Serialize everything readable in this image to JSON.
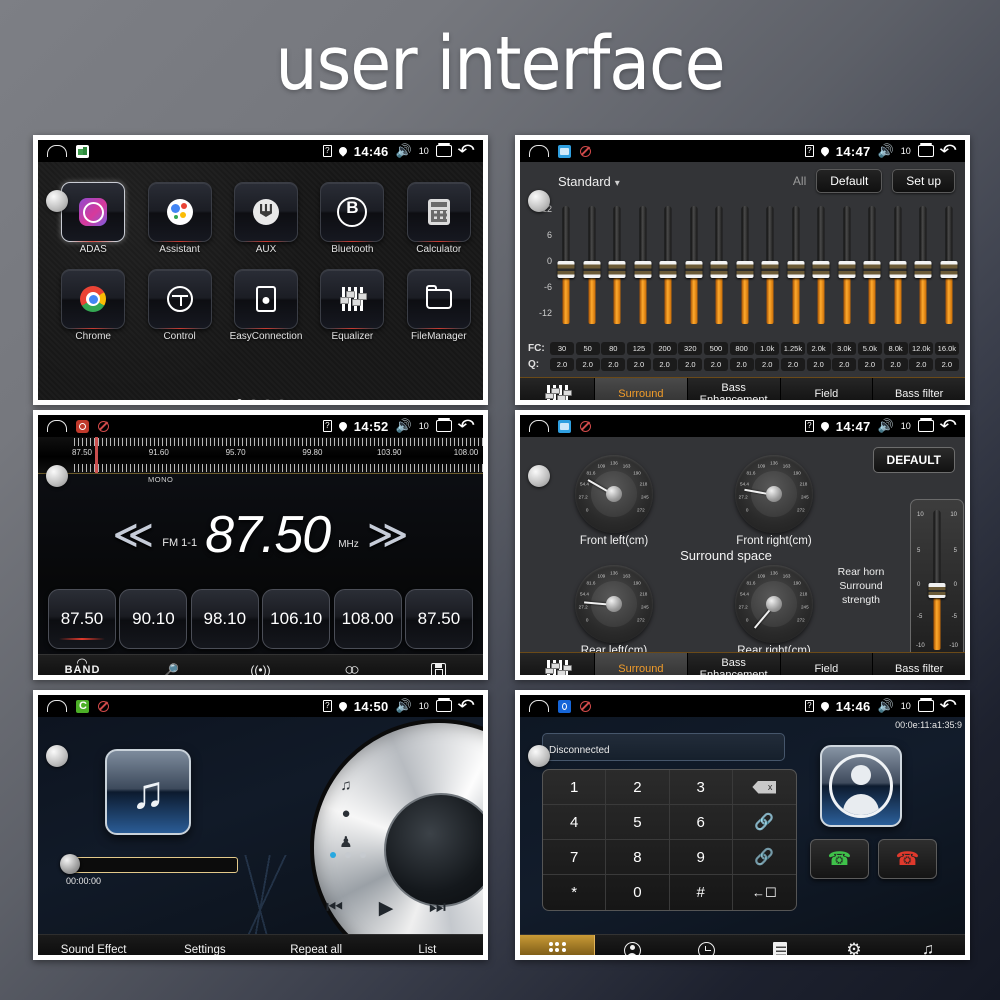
{
  "page": {
    "title": "user interface"
  },
  "statusbar_common": {
    "sim_icon": "sim-card-icon",
    "location_icon": "location-pin-icon",
    "volume_icon": "volume-icon",
    "volume_level": "10",
    "recents_icon": "recents-icon",
    "back_icon": "back-icon",
    "home_icon": "car-home-icon"
  },
  "panels": {
    "launcher": {
      "name": "app-launcher",
      "status": {
        "time": "14:46",
        "volume_level": "10",
        "app_badge": "home-app-icon"
      },
      "apps": [
        {
          "label": "ADAS",
          "icon": "adas-icon",
          "selected": true
        },
        {
          "label": "Assistant",
          "icon": "google-assistant-icon",
          "selected": false
        },
        {
          "label": "AUX",
          "icon": "aux-icon",
          "selected": false
        },
        {
          "label": "Bluetooth",
          "icon": "bluetooth-icon",
          "selected": false
        },
        {
          "label": "Calculator",
          "icon": "calculator-icon",
          "selected": false
        },
        {
          "label": "Chrome",
          "icon": "chrome-icon",
          "selected": false
        },
        {
          "label": "Control",
          "icon": "steering-wheel-icon",
          "selected": false
        },
        {
          "label": "EasyConnection",
          "icon": "easyconnection-icon",
          "selected": false
        },
        {
          "label": "Equalizer",
          "icon": "equalizer-icon",
          "selected": false
        },
        {
          "label": "FileManager",
          "icon": "folder-icon",
          "selected": false
        }
      ],
      "page_dots": {
        "count": 4,
        "active_index": 0
      }
    },
    "equalizer": {
      "name": "equalizer",
      "status": {
        "time": "14:47",
        "volume_level": "10",
        "app_badge": "blue-app-icon"
      },
      "preset": "Standard",
      "all_label": "All",
      "default_button": "Default",
      "setup_button": "Set up",
      "axis_labels": [
        "12",
        "6",
        "0",
        "-6",
        "-12"
      ],
      "fc_label": "FC:",
      "q_label": "Q:",
      "bands": [
        {
          "fc": "30",
          "q": "2.0",
          "gain": 0
        },
        {
          "fc": "50",
          "q": "2.0",
          "gain": 0
        },
        {
          "fc": "80",
          "q": "2.0",
          "gain": 0
        },
        {
          "fc": "125",
          "q": "2.0",
          "gain": 0
        },
        {
          "fc": "200",
          "q": "2.0",
          "gain": 0
        },
        {
          "fc": "320",
          "q": "2.0",
          "gain": 0
        },
        {
          "fc": "500",
          "q": "2.0",
          "gain": 0
        },
        {
          "fc": "800",
          "q": "2.0",
          "gain": 0
        },
        {
          "fc": "1.0k",
          "q": "2.0",
          "gain": 0
        },
        {
          "fc": "1.25k",
          "q": "2.0",
          "gain": 0
        },
        {
          "fc": "2.0k",
          "q": "2.0",
          "gain": 0
        },
        {
          "fc": "3.0k",
          "q": "2.0",
          "gain": 0
        },
        {
          "fc": "5.0k",
          "q": "2.0",
          "gain": 0
        },
        {
          "fc": "8.0k",
          "q": "2.0",
          "gain": 0
        },
        {
          "fc": "12.0k",
          "q": "2.0",
          "gain": 0
        },
        {
          "fc": "16.0k",
          "q": "2.0",
          "gain": 0
        }
      ],
      "tabs": [
        {
          "label": "",
          "icon": "equalizer-sliders-icon",
          "active": false
        },
        {
          "label": "Surround",
          "active": true
        },
        {
          "label": "Bass Enhancement",
          "active": false
        },
        {
          "label": "Field",
          "active": false
        },
        {
          "label": "Bass filter",
          "active": false
        }
      ]
    },
    "radio": {
      "name": "fm-radio",
      "status": {
        "time": "14:52",
        "volume_level": "10",
        "app_badge": "radio-app-icon"
      },
      "scale_ticks": [
        "87.50",
        "91.60",
        "95.70",
        "99.80",
        "103.90",
        "108.00"
      ],
      "mono_label": "MONO",
      "band_label": "FM 1-1",
      "frequency": "87.50",
      "unit": "MHz",
      "prev_icon": "prev-station-icon",
      "next_icon": "next-station-icon",
      "presets": [
        {
          "value": "87.50",
          "active": true
        },
        {
          "value": "90.10",
          "active": false
        },
        {
          "value": "98.10",
          "active": false
        },
        {
          "value": "106.10",
          "active": false
        },
        {
          "value": "108.00",
          "active": false
        },
        {
          "value": "87.50",
          "active": false
        }
      ],
      "bottom_bar": [
        {
          "label": "BAND",
          "icon": "band-icon"
        },
        {
          "label": "",
          "icon": "scan-search-icon"
        },
        {
          "label": "",
          "icon": "antenna-icon"
        },
        {
          "label": "",
          "icon": "stereo-loop-icon"
        },
        {
          "label": "",
          "icon": "save-icon"
        }
      ]
    },
    "surround": {
      "name": "surround-space",
      "status": {
        "time": "14:47",
        "volume_level": "10",
        "app_badge": "blue-app-icon"
      },
      "default_button": "DEFAULT",
      "center_title": "Surround space",
      "dials": [
        {
          "label": "Front left(cm)",
          "angle": -150
        },
        {
          "label": "Front right(cm)",
          "angle": -170
        },
        {
          "label": "Rear left(cm)",
          "angle": -175
        },
        {
          "label": "Rear right(cm)",
          "angle": 130
        }
      ],
      "dial_ticks": [
        "0",
        "27.2",
        "54.4",
        "81.6",
        "109",
        "136",
        "163",
        "190",
        "218",
        "245",
        "272"
      ],
      "slider_label": "Rear horn Surround strength",
      "slider_scale": [
        "10",
        "5",
        "0",
        "-5",
        "-10"
      ],
      "tabs": [
        {
          "label": "",
          "icon": "equalizer-sliders-icon",
          "active": false
        },
        {
          "label": "Surround",
          "active": true
        },
        {
          "label": "Bass Enhancement",
          "active": false
        },
        {
          "label": "Field",
          "active": false
        },
        {
          "label": "Bass filter",
          "active": false
        }
      ]
    },
    "music": {
      "name": "music-player",
      "status": {
        "time": "14:50",
        "volume_level": "10",
        "app_badge": "music-app-icon"
      },
      "album_icon": "music-note-icon",
      "elapsed_time": "00:00:00",
      "progress_percent": 0,
      "side_icons": [
        "music-note-icon",
        "disc-icon",
        "artist-icon"
      ],
      "page_dots": {
        "count": 3,
        "active_index": 0
      },
      "transport": [
        {
          "icon": "previous-track-icon"
        },
        {
          "icon": "play-icon"
        },
        {
          "icon": "next-track-icon"
        }
      ],
      "bottom_bar": [
        "Sound Effect",
        "Settings",
        "Repeat all",
        "List"
      ]
    },
    "bluetooth": {
      "name": "bluetooth-phone",
      "status": {
        "time": "14:46",
        "volume_level": "10",
        "app_badge": "bluetooth-app-icon"
      },
      "mac_address": "00:0e:11:a1:35:9",
      "connection_status": "Disconnected",
      "keys": [
        {
          "label": "1"
        },
        {
          "label": "2"
        },
        {
          "label": "3"
        },
        {
          "label": "",
          "icon": "backspace-icon"
        },
        {
          "label": "4"
        },
        {
          "label": "5"
        },
        {
          "label": "6"
        },
        {
          "label": "🔗",
          "icon": "link-icon"
        },
        {
          "label": "7"
        },
        {
          "label": "8"
        },
        {
          "label": "9"
        },
        {
          "label": "",
          "icon": "unlink-icon"
        },
        {
          "label": "*"
        },
        {
          "label": "0"
        },
        {
          "label": "#",
          "icon": ""
        },
        {
          "label": "",
          "icon": "transfer-call-icon"
        }
      ],
      "avatar_icon": "contact-avatar-icon",
      "accept_icon": "accept-call-icon",
      "reject_icon": "reject-call-icon",
      "nav": [
        {
          "icon": "dialpad-icon",
          "active": true
        },
        {
          "icon": "contacts-icon",
          "active": false
        },
        {
          "icon": "recent-calls-icon",
          "active": false
        },
        {
          "icon": "call-log-icon",
          "active": false
        },
        {
          "icon": "settings-gear-icon",
          "active": false
        },
        {
          "icon": "bt-music-icon",
          "active": false
        }
      ]
    }
  }
}
